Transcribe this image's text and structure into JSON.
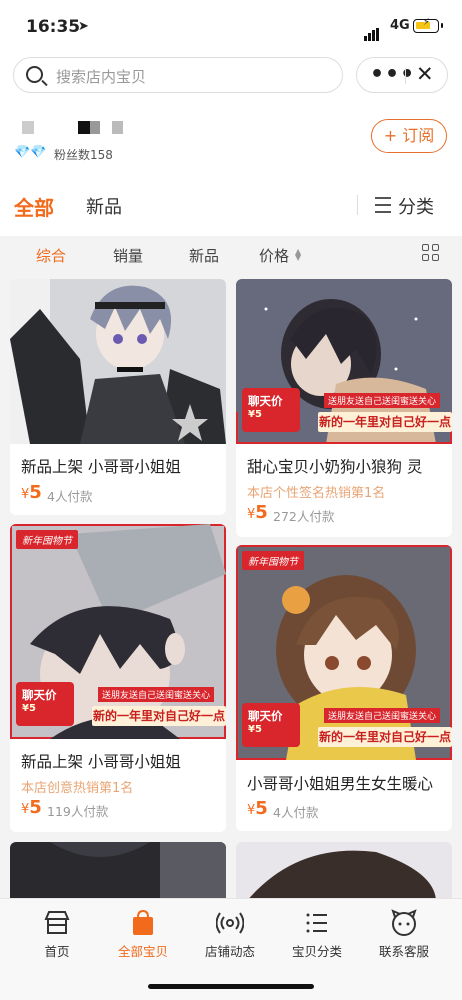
{
  "status": {
    "time": "16:35",
    "network": "4G"
  },
  "search": {
    "placeholder": "搜索店内宝贝",
    "more": "•••",
    "close": "✕"
  },
  "shop": {
    "fans_label": "粉丝数158",
    "subscribe": "+ 订阅"
  },
  "tabs": {
    "all": "全部",
    "new": "新品",
    "category": "分类"
  },
  "sort": {
    "comprehensive": "综合",
    "sales": "销量",
    "new": "新品",
    "price": "价格"
  },
  "banner": {
    "chat": "聊天价",
    "chat_price": "¥5",
    "top_line": "送朋友送自己送闺蜜送关心",
    "slogan": "新的一年里对自己好一点",
    "new_year": "新年囤物节"
  },
  "products": [
    {
      "title": "新品上架 小哥哥小姐姐",
      "rank": "",
      "price": "5",
      "sold": "4人付款"
    },
    {
      "title": "甜心宝贝小奶狗小狼狗 灵",
      "rank": "本店个性签名热销第1名",
      "price": "5",
      "sold": "272人付款"
    },
    {
      "title": "新品上架 小哥哥小姐姐",
      "rank": "本店创意热销第1名",
      "price": "5",
      "sold": "119人付款"
    },
    {
      "title": "小哥哥小姐姐男生女生暖心",
      "rank": "",
      "price": "5",
      "sold": "4人付款"
    }
  ],
  "nav": {
    "home": "首页",
    "all": "全部宝贝",
    "feed": "店铺动态",
    "category": "宝贝分类",
    "service": "联系客服"
  },
  "colors": {
    "accent": "#f26a1b",
    "banner_red": "#d8262c"
  }
}
